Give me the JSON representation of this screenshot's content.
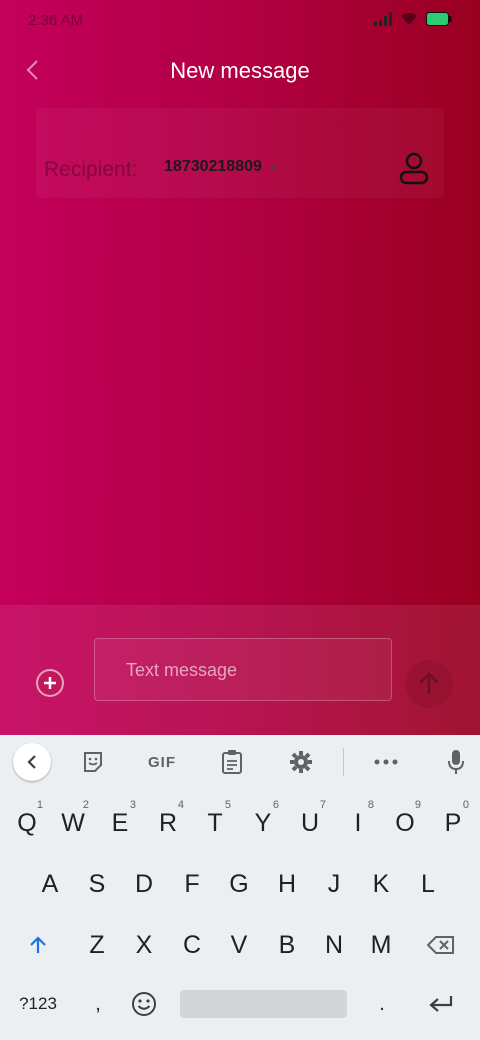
{
  "status": {
    "time": "2:36 AM"
  },
  "header": {
    "title": "New message"
  },
  "recipient": {
    "label": "Recipient:",
    "number": "18730218809",
    "remove": "×"
  },
  "compose": {
    "placeholder": "Text message"
  },
  "keyboard": {
    "toolbar": {
      "gif": "GIF"
    },
    "row1": [
      {
        "k": "Q",
        "h": "1"
      },
      {
        "k": "W",
        "h": "2"
      },
      {
        "k": "E",
        "h": "3"
      },
      {
        "k": "R",
        "h": "4"
      },
      {
        "k": "T",
        "h": "5"
      },
      {
        "k": "Y",
        "h": "6"
      },
      {
        "k": "U",
        "h": "7"
      },
      {
        "k": "I",
        "h": "8"
      },
      {
        "k": "O",
        "h": "9"
      },
      {
        "k": "P",
        "h": "0"
      }
    ],
    "row2": [
      "A",
      "S",
      "D",
      "F",
      "G",
      "H",
      "J",
      "K",
      "L"
    ],
    "row3": [
      "Z",
      "X",
      "C",
      "V",
      "B",
      "N",
      "M"
    ],
    "bottom": {
      "symbols": "?123",
      "comma": ",",
      "period": "."
    }
  },
  "colors": {
    "accent": "#c2185b",
    "shift_blue": "#1a73e8",
    "battery": "#2ecc71"
  }
}
